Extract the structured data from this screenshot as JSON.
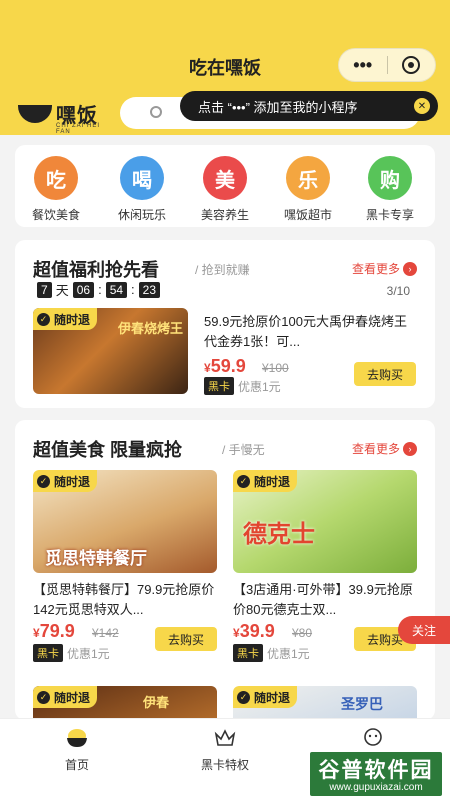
{
  "header": {
    "title": "吃在嘿饭",
    "more_label": "•••",
    "logo_name": "嘿饭",
    "logo_sub": "CHI ZAI HEI FAN",
    "tip_text": "点击 “•••” 添加至我的小程序",
    "tip_close": "✕"
  },
  "categories": [
    {
      "icon_char": "吃",
      "label": "餐饮美食",
      "color": "#f0873a"
    },
    {
      "icon_char": "喝",
      "label": "休闲玩乐",
      "color": "#4a9ee8"
    },
    {
      "icon_char": "美",
      "label": "美容养生",
      "color": "#ea4b4b"
    },
    {
      "icon_char": "乐",
      "label": "嘿饭超市",
      "color": "#f4a640"
    },
    {
      "icon_char": "购",
      "label": "黑卡专享",
      "color": "#58c459"
    }
  ],
  "flash": {
    "title": "超值福利抢先看",
    "subtitle": "/ 抢到就赚",
    "more": "查看更多",
    "countdown": {
      "days": "7",
      "day_unit": "天",
      "h": "06",
      "m": "54",
      "s": "23"
    },
    "pager": "3/10",
    "item": {
      "tag": "随时退",
      "title": "59.9元抢原价100元大禹伊春烧烤王代金券1张！可...",
      "price_symbol": "¥",
      "price": "59.9",
      "orig": "¥100",
      "vip_badge": "黑卡",
      "vip_text": "优惠1元",
      "buy": "去购买",
      "image_label": "伊春烧烤王"
    }
  },
  "deals": {
    "title": "超值美食 限量疯抢",
    "subtitle": "/ 手慢无",
    "more": "查看更多",
    "items": [
      {
        "tag": "随时退",
        "title": "【觅思特韩餐厅】79.9元抢原价142元觅思特双人...",
        "price_symbol": "¥",
        "price": "79.9",
        "orig": "¥142",
        "vip_badge": "黑卡",
        "vip_text": "优惠1元",
        "buy": "去购买",
        "image_label": "觅思特韩餐厅"
      },
      {
        "tag": "随时退",
        "title": "【3店通用·可外带】39.9元抢原价80元德克士双...",
        "price_symbol": "¥",
        "price": "39.9",
        "orig": "¥80",
        "vip_badge": "黑卡",
        "vip_text": "优惠1元",
        "buy": "去购买",
        "image_label": "德克士"
      }
    ],
    "next_row": [
      {
        "tag": "随时退",
        "image_label": "伊春"
      },
      {
        "tag": "随时退",
        "image_label": "圣罗巴"
      }
    ]
  },
  "follow": "关注",
  "tabs": [
    {
      "label": "首页"
    },
    {
      "label": "黑卡特权"
    },
    {
      "label": "我的"
    }
  ],
  "watermark": {
    "big": "谷普软件园",
    "url": "www.gupuxiazai.com"
  }
}
